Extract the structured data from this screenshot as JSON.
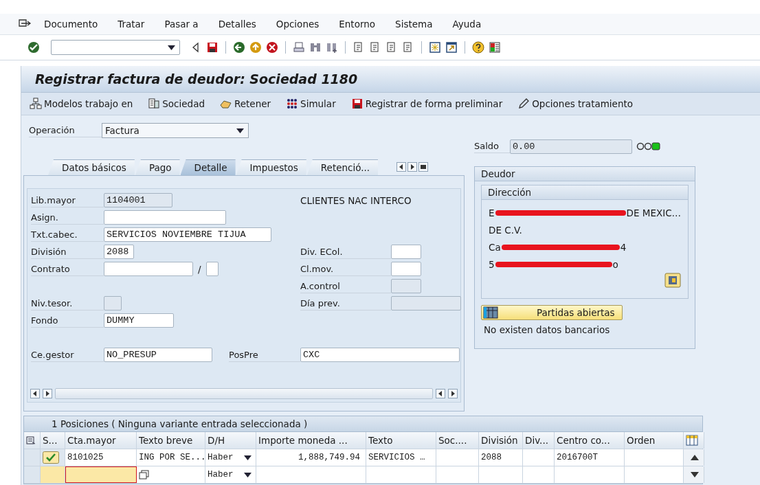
{
  "menu": [
    "Documento",
    "Tratar",
    "Pasar a",
    "Detalles",
    "Opciones",
    "Entorno",
    "Sistema",
    "Ayuda"
  ],
  "title": "Registrar factura de deudor: Sociedad 1180",
  "app_toolbar": [
    "Modelos trabajo en",
    "Sociedad",
    "Retener",
    "Simular",
    "Registrar de forma preliminar",
    "Opciones tratamiento"
  ],
  "operation": {
    "label": "Operación",
    "value": "Factura"
  },
  "tabs": [
    {
      "label": "Datos básicos",
      "selected": false
    },
    {
      "label": "Pago",
      "selected": false
    },
    {
      "label": "Detalle",
      "selected": true
    },
    {
      "label": "Impuestos",
      "selected": false
    },
    {
      "label": "Retenció...",
      "selected": false
    }
  ],
  "rows": [
    {
      "kind": "fields",
      "left": {
        "label": "Lib.mayor",
        "value": "1104001",
        "disabled": true
      },
      "right": {
        "kind": "text",
        "text": "CLIENTES NAC INTERCO"
      }
    },
    {
      "kind": "fields",
      "left": {
        "label": "Asign.",
        "disabled": false
      }
    },
    {
      "kind": "fields",
      "left": {
        "label": "Txt.cabec.",
        "value": "SERVICIOS NOVIEMBRE TIJUA",
        "disabled": false
      }
    },
    {
      "kind": "fields",
      "left": {
        "label": "División",
        "value": "2088",
        "disabled": false
      },
      "right": {
        "kind": "field",
        "label": "Div. ECol.",
        "disabled": false
      }
    },
    {
      "kind": "fields",
      "left": {
        "label": "Contrato",
        "separator": "/",
        "disabled": false
      },
      "right": {
        "kind": "field",
        "label": "Cl.mov.",
        "disabled": false
      }
    },
    {
      "kind": "fields",
      "right": {
        "kind": "field",
        "label": "A.control",
        "disabled": true
      }
    },
    {
      "kind": "fields",
      "left": {
        "label": "Niv.tesor.",
        "disabled": true
      },
      "right": {
        "kind": "field",
        "label": "Día prev.",
        "disabled": true
      }
    },
    {
      "kind": "fields",
      "left": {
        "label": "Fondo",
        "value": "DUMMY",
        "disabled": false
      }
    },
    {
      "kind": "spacer"
    },
    {
      "kind": "fields",
      "left": {
        "label": "Ce.gestor",
        "value": "NO_PRESUP",
        "disabled": false
      },
      "right": {
        "kind": "field",
        "label": "PosPre",
        "value": "CXC",
        "disabled": false
      }
    }
  ],
  "saldo": {
    "label": "Saldo",
    "value": "0.00"
  },
  "deudor": {
    "title": "Deudor",
    "address_title": "Dirección",
    "address_lines": [
      {
        "kind": "redacted",
        "prefix": "E",
        "suffix": "DE MEXIC…"
      },
      {
        "kind": "plain",
        "text": "DE C.V."
      },
      {
        "kind": "redacted",
        "prefix": "Ca",
        "suffix": "4"
      },
      {
        "kind": "redacted",
        "prefix": "5",
        "suffix": "o"
      }
    ],
    "button": "Partidas abiertas",
    "note": "No existen datos bancarios"
  },
  "items": {
    "title": "1 Posiciones ( Ninguna variante entrada seleccionada )",
    "status_column": "S...",
    "columns": [
      "Cta.mayor",
      "Texto breve",
      "D/H",
      "Importe moneda ...",
      "Texto",
      "Soc....",
      "División",
      "Div...",
      "Centro co...",
      "Orden"
    ],
    "rows": [
      {
        "checked": true,
        "cells": [
          "8101025",
          "ING POR SE...",
          "Haber",
          "1,888,749.94",
          "SERVICIOS …",
          "",
          "2088",
          "",
          "2016700T",
          ""
        ],
        "editing": false
      },
      {
        "checked": false,
        "cells": [
          "",
          "",
          "Haber",
          "",
          "",
          "",
          "",
          "",
          "",
          ""
        ],
        "editing": true
      }
    ]
  }
}
